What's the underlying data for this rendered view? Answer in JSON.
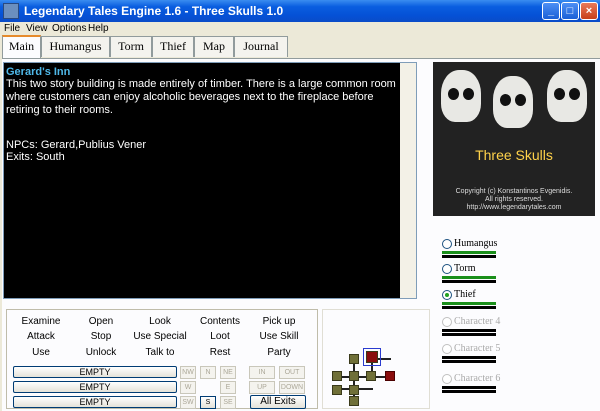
{
  "window": {
    "title": "Legendary Tales Engine 1.6 - Three Skulls 1.0",
    "minimize": "_",
    "maximize": "□",
    "close": "×"
  },
  "menu": [
    "File",
    "View",
    "Options",
    "Help"
  ],
  "tabs": [
    "Main",
    "Humangus",
    "Torm",
    "Thief",
    "Map",
    "Journal"
  ],
  "active_tab": "Main",
  "room": {
    "title": "Gerard's Inn",
    "description": "This two story building is made entirely of timber. There is a large common room where customers can enjoy alcoholic beverages next to the fireplace before retiring to their rooms.",
    "npcs": "NPCs: Gerard,Publius Vener",
    "exits": "Exits: South"
  },
  "banner": {
    "game_name": "Three Skulls",
    "copyright_1": "Copyright (c) Konstantinos Evgenidis.",
    "copyright_2": "All rights reserved.",
    "url": "http://www.legendarytales.com"
  },
  "characters": [
    {
      "name": "Humangus",
      "selected": false,
      "enabled": true
    },
    {
      "name": "Torm",
      "selected": false,
      "enabled": true
    },
    {
      "name": "Thief",
      "selected": true,
      "enabled": true
    },
    {
      "name": "Character 4",
      "selected": false,
      "enabled": false
    },
    {
      "name": "Character 5",
      "selected": false,
      "enabled": false
    },
    {
      "name": "Character 6",
      "selected": false,
      "enabled": false
    }
  ],
  "commands": {
    "row1": [
      "Examine",
      "Open",
      "Look",
      "Contents",
      "Pick up"
    ],
    "row2": [
      "Attack",
      "Stop",
      "Use Special",
      "Loot",
      "Use Skill"
    ],
    "row3": [
      "Use",
      "Unlock",
      "Talk to",
      "Rest",
      "Party"
    ]
  },
  "slots": [
    "EMPTY",
    "EMPTY",
    "EMPTY"
  ],
  "directions": {
    "nw": "NW",
    "n": "N",
    "ne": "NE",
    "w": "W",
    "e": "E",
    "sw": "SW",
    "s": "S",
    "se": "SE",
    "in": "IN",
    "out": "OUT",
    "up": "UP",
    "down": "DOWN",
    "all_exits": "All Exits"
  }
}
